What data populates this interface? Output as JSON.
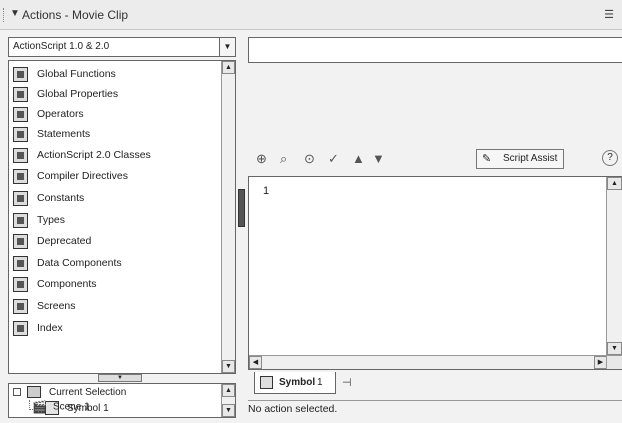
{
  "window": {
    "title": "Actions - Movie Clip",
    "options_glyph": "☰"
  },
  "toolbox": {
    "version_selected": "ActionScript 1.0 & 2.0",
    "items": [
      {
        "label": "Global Functions",
        "icon": "book-icon"
      },
      {
        "label": "Global Properties",
        "icon": "book-icon"
      },
      {
        "label": "Operators",
        "icon": "book-icon"
      },
      {
        "label": "Statements",
        "icon": "book-icon"
      },
      {
        "label": "ActionScript 2.0 Classes",
        "icon": "book-icon"
      },
      {
        "label": "Compiler Directives",
        "icon": "book-icon"
      },
      {
        "label": "Constants",
        "icon": "book-icon"
      },
      {
        "label": "Types",
        "icon": "book-icon"
      },
      {
        "label": "Deprecated",
        "icon": "book-icon"
      },
      {
        "label": "Data Components",
        "icon": "book-icon"
      },
      {
        "label": "Components",
        "icon": "book-icon"
      },
      {
        "label": "Screens",
        "icon": "book-icon"
      },
      {
        "label": "Index",
        "icon": "book-icon"
      }
    ]
  },
  "script_navigator": {
    "current_selection": "Current Selection",
    "symbol": "Symbol 1",
    "scene": "Scene 1"
  },
  "editor_toolbar": {
    "icons": [
      "add-icon",
      "find-icon",
      "insert-target-path-icon",
      "check-syntax-icon",
      "up-arrow-icon",
      "down-arrow-icon"
    ],
    "script_assist_label": "Script Assist"
  },
  "editor": {
    "line_number": "1"
  },
  "tabs": [
    {
      "label": "Symbol",
      "number": "1"
    }
  ],
  "status": {
    "text": "No action selected."
  }
}
